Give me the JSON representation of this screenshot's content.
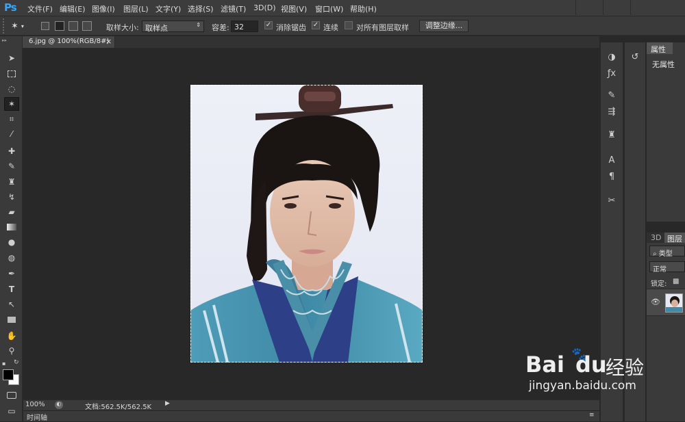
{
  "app": {
    "logo": "Ps"
  },
  "menu": [
    "文件(F)",
    "编辑(E)",
    "图像(I)",
    "图层(L)",
    "文字(Y)",
    "选择(S)",
    "滤镜(T)",
    "3D(D)",
    "视图(V)",
    "窗口(W)",
    "帮助(H)"
  ],
  "options": {
    "sample_size_label": "取样大小:",
    "sample_size_value": "取样点",
    "tolerance_label": "容差:",
    "tolerance_value": "32",
    "antialias_label": "消除锯齿",
    "antialias_checked": true,
    "contiguous_label": "连续",
    "contiguous_checked": true,
    "sample_all_label": "对所有图层取样",
    "sample_all_checked": false,
    "refine_edge_label": "调整边缘..."
  },
  "document": {
    "tab_title": "6.jpg @ 100%(RGB/8#)",
    "close": "×"
  },
  "status": {
    "zoom": "100%",
    "doc_size": "文档:562.5K/562.5K"
  },
  "timeline": {
    "label": "时间轴"
  },
  "properties": {
    "tab": "属性",
    "content": "无属性"
  },
  "layers": {
    "tab_3d": "3D",
    "tab_layers": "图层",
    "filter_kind": "类型",
    "blend_mode": "正常",
    "lock_label": "锁定:"
  },
  "watermark": {
    "brand": "Bai",
    "brand2": "du",
    "suffix": "经验",
    "url": "jingyan.baidu.com"
  },
  "colors": {
    "accent": "#31a8ff",
    "selection": "#ffffff",
    "robe": "#3f8aa6"
  }
}
